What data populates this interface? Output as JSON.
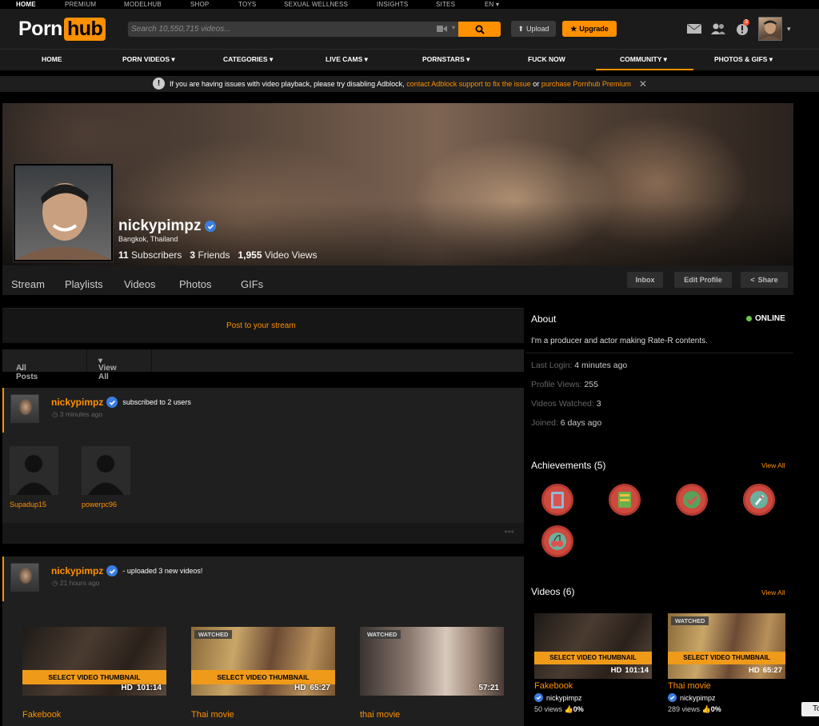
{
  "topbar": [
    "HOME",
    "PREMIUM",
    "MODELHUB",
    "SHOP",
    "TOYS",
    "SEXUAL WELLNESS",
    "INSIGHTS",
    "SITES",
    "EN"
  ],
  "logo": {
    "part1": "Porn",
    "part2": "hub"
  },
  "search": {
    "placeholder": "Search 10,550,715 videos..."
  },
  "header": {
    "upload": "Upload",
    "upgrade": "Upgrade",
    "notif_count": "3"
  },
  "nav": [
    "HOME",
    "PORN VIDEOS",
    "CATEGORIES",
    "LIVE CAMS",
    "PORNSTARS",
    "FUCK NOW",
    "COMMUNITY",
    "PHOTOS & GIFS"
  ],
  "notice": {
    "text1": "If you are having issues with video playback, please try disabling Adblock,",
    "link1": "contact Adblock support to fix the issue",
    "text2": "or",
    "link2": "purchase Pornhub Premium"
  },
  "profile": {
    "username": "nickypimpz",
    "location": "Bangkok, Thailand",
    "subscribers_n": "11",
    "subscribers_l": "Subscribers",
    "friends_n": "3",
    "friends_l": "Friends",
    "views_n": "1,955",
    "views_l": "Video Views"
  },
  "tabs": [
    "Stream",
    "Playlists",
    "Videos",
    "Photos",
    "GIFs"
  ],
  "buttons": {
    "inbox": "Inbox",
    "edit": "Edit Profile",
    "share": "Share"
  },
  "stream": {
    "post": "Post to your stream",
    "all_posts": "All Posts",
    "view_all": "View All",
    "item1": {
      "user": "nickypimpz",
      "action": "subscribed to 2 users",
      "time": "3 minutes ago",
      "users": [
        "Supadup15",
        "powerpc96"
      ]
    },
    "item2": {
      "user": "nickypimpz",
      "action": "- uploaded 3 new videos!",
      "time": "21 hours ago"
    },
    "videos": [
      {
        "title": "Fakebook",
        "duration": "101:14",
        "hd": "HD",
        "select": "SELECT VIDEO THUMBNAIL",
        "watched": ""
      },
      {
        "title": "Thai movie",
        "duration": "65:27",
        "hd": "HD",
        "select": "SELECT VIDEO THUMBNAIL",
        "watched": "WATCHED"
      },
      {
        "title": "thai movie",
        "duration": "57:21",
        "hd": "",
        "select": "",
        "watched": "WATCHED"
      }
    ]
  },
  "about": {
    "title": "About",
    "status": "ONLINE",
    "text": "I'm a producer and actor making Rate-R contents.",
    "last_login_l": "Last Login:",
    "last_login": "4 minutes ago",
    "profile_views_l": "Profile Views:",
    "profile_views": "255",
    "videos_watched_l": "Videos Watched:",
    "videos_watched": "3",
    "joined_l": "Joined:",
    "joined": "6 days ago"
  },
  "achievements": {
    "title": "Achievements (5)",
    "view_all": "View All"
  },
  "right_videos": {
    "title": "Videos (6)",
    "view_all": "View All",
    "items": [
      {
        "title": "Fakebook",
        "user": "nickypimpz",
        "views": "50 views",
        "rating": "0%",
        "duration": "101:14",
        "hd": "HD",
        "select": "SELECT VIDEO THUMBNAIL",
        "watched": ""
      },
      {
        "title": "Thai movie",
        "user": "nickypimpz",
        "views": "289 views",
        "rating": "0%",
        "duration": "65:27",
        "hd": "HD",
        "select": "SELECT VIDEO THUMBNAIL",
        "watched": "WATCHED"
      }
    ]
  },
  "tooltip": "To",
  "colors": {
    "accent": "#ff9000",
    "bg": "#000000",
    "panel": "#1f1f1f",
    "verified": "#3b7de0",
    "online": "#6ac34d"
  }
}
